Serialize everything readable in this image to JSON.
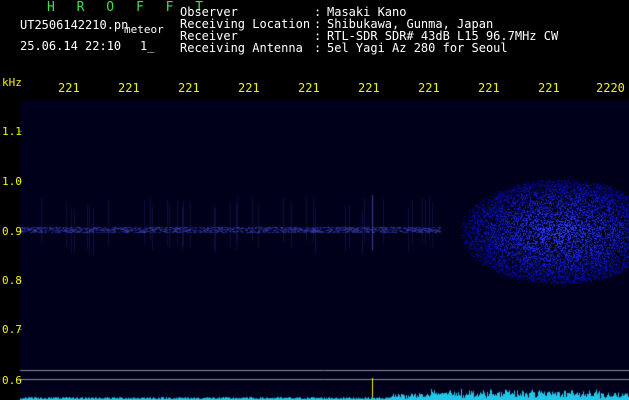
{
  "program": {
    "name": "H R O F F T"
  },
  "file": {
    "filename": "UT2506142210.pn",
    "datetime": "25.06.14 22:10",
    "ref": "1_",
    "tag": "meteor"
  },
  "header": {
    "rows": [
      {
        "label": "Observer",
        "value": "Masaki Kano"
      },
      {
        "label": "Receiving Location",
        "value": "Shibukawa, Gunma, Japan"
      },
      {
        "label": "Receiver",
        "value": "RTL-SDR SDR# 43dB L15 96.7MHz CW"
      },
      {
        "label": "Receiving Antenna",
        "value": "5el Yagi Az 280 for Seoul"
      }
    ],
    "separator": ":"
  },
  "axes": {
    "y_unit": "kHz",
    "x_ticks": [
      "221",
      "221",
      "221",
      "221",
      "221",
      "221",
      "221",
      "221",
      "221",
      "2220"
    ],
    "y_ticks": [
      "1.1",
      "1.0",
      "0.9",
      "0.8",
      "0.7",
      "0.6"
    ]
  },
  "colors": {
    "background": "#000000",
    "text_white": "#ffffff",
    "accent_yellow": "#f2f200",
    "program_green": "#3ee04a",
    "signal_blue": "#3a4cff",
    "baseline_cyan": "#22c6e8"
  }
}
